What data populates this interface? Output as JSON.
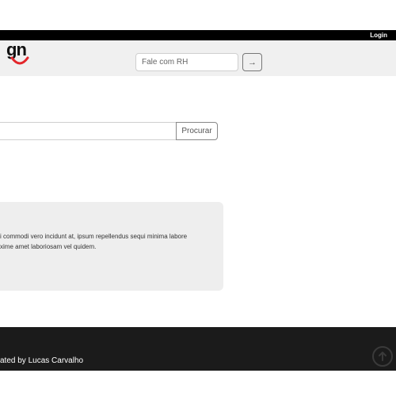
{
  "topbar": {
    "login_label": "Login"
  },
  "header": {
    "logo_text": "gn",
    "rh_input": {
      "placeholder": "Fale com RH",
      "value": ""
    },
    "rh_submit_icon": "arrow-right-icon",
    "rh_submit_label": "→"
  },
  "search": {
    "placeholder": "",
    "value": "",
    "button_label": "Procurar"
  },
  "info_card": {
    "lines": [
      "i commodi vero incidunt at, ipsum repellendus sequi minima labore",
      "xime amet laboriosam vel quidem."
    ]
  },
  "footer": {
    "credit": "ated by Lucas Carvalho",
    "back_to_top_icon": "arrow-up-circle-icon"
  },
  "colors": {
    "accent_red": "#e3262b",
    "header_bg": "#f0f0f0",
    "footer_bg": "#1b1b1b",
    "topbar_bg": "#000000"
  }
}
